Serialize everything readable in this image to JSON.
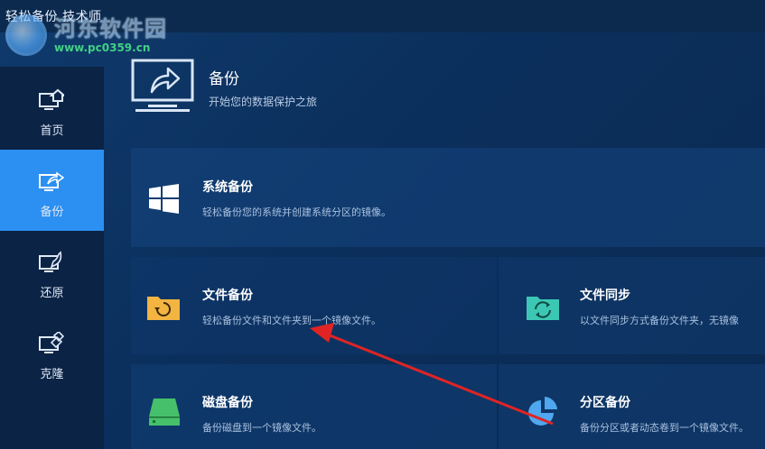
{
  "app": {
    "title": "轻松备份 技术师"
  },
  "watermark": {
    "text": "河东软件园",
    "url": "www.pc0359.cn"
  },
  "sidebar": {
    "items": [
      {
        "label": "首页",
        "icon": "home-icon",
        "active": false
      },
      {
        "label": "备份",
        "icon": "backup-icon",
        "active": true
      },
      {
        "label": "还原",
        "icon": "restore-icon",
        "active": false
      },
      {
        "label": "克隆",
        "icon": "clone-icon",
        "active": false
      }
    ]
  },
  "header": {
    "title": "备份",
    "subtitle": "开始您的数据保护之旅",
    "icon": "monitor-share-icon"
  },
  "cards": {
    "system": {
      "title": "系统备份",
      "desc": "轻松备份您的系统并创建系统分区的镜像。",
      "icon": "windows-icon"
    },
    "file": {
      "title": "文件备份",
      "desc": "轻松备份文件和文件夹到一个镜像文件。",
      "icon": "folder-refresh-icon"
    },
    "sync": {
      "title": "文件同步",
      "desc": "以文件同步方式备份文件夹，无镜像",
      "icon": "folder-sync-icon"
    },
    "disk": {
      "title": "磁盘备份",
      "desc": "备份磁盘到一个镜像文件。",
      "icon": "disk-icon"
    },
    "partition": {
      "title": "分区备份",
      "desc": "备份分区或者动态卷到一个镜像文件。",
      "icon": "pie-chart-icon"
    }
  },
  "colors": {
    "accent": "#2c8ff2",
    "arrow": "#e02424",
    "folder": "#f3b441",
    "sync": "#3cc7b4",
    "disk": "#46c06a",
    "pie": "#4fa7ef"
  }
}
